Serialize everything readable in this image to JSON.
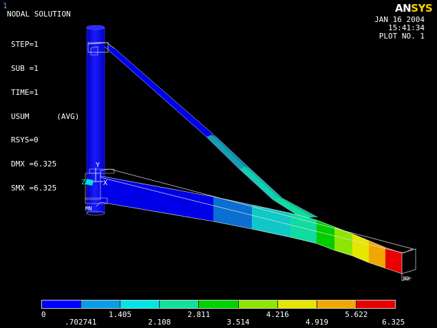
{
  "window_number": "1",
  "plot_info": {
    "title": "NODAL SOLUTION",
    "lines": [
      "STEP=1",
      "SUB =1",
      "TIME=1",
      "USUM      (AVG)",
      "RSYS=0",
      "DMX =6.325",
      "SMX =6.325"
    ]
  },
  "logo": {
    "part1": "AN",
    "part2": "SYS"
  },
  "stamp": {
    "date": "JAN 16 2004",
    "time": "15:41:34",
    "plot_no": "PLOT NO.   1"
  },
  "triad": {
    "y": "Y",
    "z": "Z",
    "x": "X"
  },
  "markers": {
    "mn": "MN",
    "mx": "MX"
  },
  "colors": {
    "background": "#000000",
    "contour": [
      "#0000ff",
      "#0b9be8",
      "#00e6e6",
      "#10e09a",
      "#00d200",
      "#8ce600",
      "#e6e600",
      "#f0a800",
      "#e60000"
    ]
  },
  "legend": {
    "labels": [
      "0",
      ".702741",
      "1.405",
      "2.108",
      "2.811",
      "3.514",
      "4.216",
      "4.919",
      "5.622",
      "6.325"
    ]
  }
}
